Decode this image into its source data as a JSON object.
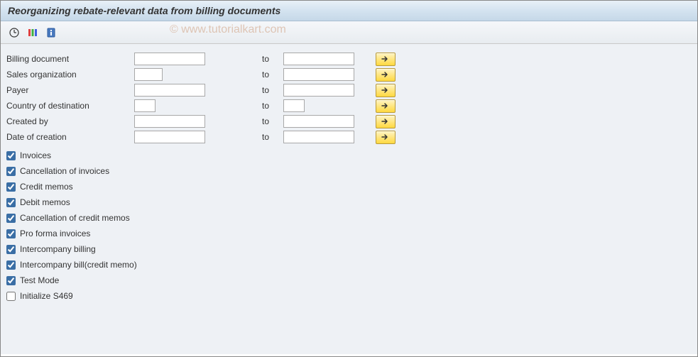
{
  "title": "Reorganizing rebate-relevant data from billing documents",
  "watermark": "© www.tutorialkart.com",
  "toolbar": {
    "execute": "Execute",
    "variant": "Get Variant",
    "info": "Information"
  },
  "fields": [
    {
      "label": "Billing document",
      "from": "",
      "to_label": "to",
      "to": "",
      "from_width": "100",
      "to_width": "100"
    },
    {
      "label": "Sales organization",
      "from": "",
      "to_label": "to",
      "to": "",
      "from_width": "40",
      "to_width": "100"
    },
    {
      "label": "Payer",
      "from": "",
      "to_label": "to",
      "to": "",
      "from_width": "100",
      "to_width": "100"
    },
    {
      "label": "Country of destination",
      "from": "",
      "to_label": "to",
      "to": "",
      "from_width": "30",
      "to_width": "30"
    },
    {
      "label": "Created by",
      "from": "",
      "to_label": "to",
      "to": "",
      "from_width": "100",
      "to_width": "100"
    },
    {
      "label": "Date of creation",
      "from": "",
      "to_label": "to",
      "to": "",
      "from_width": "100",
      "to_width": "100"
    }
  ],
  "checkboxes": [
    {
      "label": "Invoices",
      "checked": true
    },
    {
      "label": "Cancellation of invoices",
      "checked": true
    },
    {
      "label": "Credit memos",
      "checked": true
    },
    {
      "label": "Debit memos",
      "checked": true
    },
    {
      "label": "Cancellation of credit memos",
      "checked": true
    },
    {
      "label": "Pro forma invoices",
      "checked": true
    },
    {
      "label": "Intercompany billing",
      "checked": true
    },
    {
      "label": "Intercompany bill(credit memo)",
      "checked": true
    },
    {
      "label": "Test Mode",
      "checked": true
    },
    {
      "label": "Initialize S469",
      "checked": false
    }
  ]
}
